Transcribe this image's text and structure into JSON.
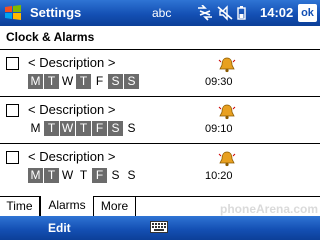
{
  "titlebar": {
    "title": "Settings",
    "sip_text": "abc",
    "clock": "14:02",
    "ok_label": "ok",
    "icons": [
      "start-icon",
      "connectivity-icon",
      "volume-muted-icon",
      "battery-icon"
    ]
  },
  "page": {
    "title": "Clock & Alarms"
  },
  "alarms": [
    {
      "enabled": false,
      "description": "< Description >",
      "time": "09:30",
      "days": [
        {
          "label": "M",
          "on": true
        },
        {
          "label": "T",
          "on": true
        },
        {
          "label": "W",
          "on": false
        },
        {
          "label": "T",
          "on": true
        },
        {
          "label": "F",
          "on": false
        },
        {
          "label": "S",
          "on": true
        },
        {
          "label": "S",
          "on": true
        }
      ]
    },
    {
      "enabled": false,
      "description": "< Description >",
      "time": "09:10",
      "days": [
        {
          "label": "M",
          "on": false
        },
        {
          "label": "T",
          "on": true
        },
        {
          "label": "W",
          "on": true
        },
        {
          "label": "T",
          "on": true
        },
        {
          "label": "F",
          "on": true
        },
        {
          "label": "S",
          "on": true
        },
        {
          "label": "S",
          "on": false
        }
      ]
    },
    {
      "enabled": false,
      "description": "< Description >",
      "time": "10:20",
      "days": [
        {
          "label": "M",
          "on": true
        },
        {
          "label": "T",
          "on": true
        },
        {
          "label": "W",
          "on": false
        },
        {
          "label": "T",
          "on": false
        },
        {
          "label": "F",
          "on": true
        },
        {
          "label": "S",
          "on": false
        },
        {
          "label": "S",
          "on": false
        }
      ]
    }
  ],
  "tabs": [
    {
      "label": "Time",
      "active": false
    },
    {
      "label": "Alarms",
      "active": true
    },
    {
      "label": "More",
      "active": false
    }
  ],
  "watermark": "phoneArena.com",
  "menubar": {
    "left_softkey": "Edit",
    "input_icon": "keyboard-icon"
  },
  "colors": {
    "titlebar": "#1450b4",
    "day_selected_bg": "#6b6b6b",
    "bell": "#e8a020"
  }
}
